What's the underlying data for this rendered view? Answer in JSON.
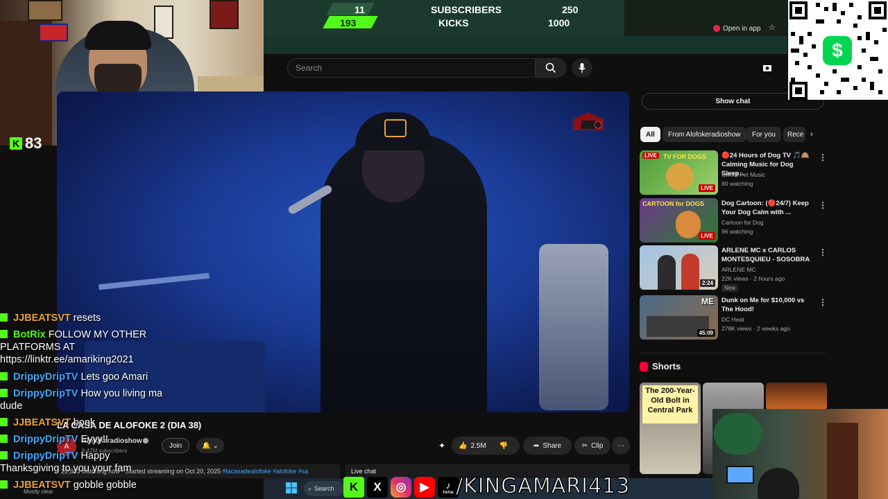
{
  "goal_bar": {
    "subs_current": "11",
    "subs_label": "SUBSCRIBERS",
    "subs_goal": "250",
    "kicks_current": "193",
    "kicks_label": "KICKS",
    "kicks_goal": "1000"
  },
  "open_in_app": "Open in app",
  "webcam": {
    "kick_count": "83"
  },
  "search": {
    "placeholder": "Search"
  },
  "video": {
    "title": "LA CASA DE ALOFOKE 2 (DIA 38)",
    "channel": "Alofokeradioshow",
    "subscribers": "8.42M subscribers",
    "join_label": "Join",
    "like_count": "2.5M",
    "share_label": "Share",
    "clip_label": "Clip",
    "description": "22,843 watching now · Started streaming on Oct 20, 2025",
    "tags": "#lacasadealofoke #alofoke #sa",
    "live_chat_label": "Live chat"
  },
  "sidebar": {
    "show_chat": "Show chat",
    "chips": [
      "All",
      "From Alofokeradioshow",
      "For you",
      "Rece"
    ],
    "recommendations": [
      {
        "title": "🔴24 Hours of Dog TV 🎵🙈 Calming Music for Dog Sleep...",
        "channel": "Sweet Pet Music",
        "meta": "80 watching",
        "badge": "LIVE",
        "thumb_text": "TV FOR DOGS",
        "thumb_colors": [
          "#4a9a3a",
          "#9ed36a"
        ]
      },
      {
        "title": "Dog Cartoon: (🔴24/7) Keep Your Dog Calm with ...",
        "channel": "Cartoon for Dog",
        "meta": "96 watching",
        "badge": "LIVE",
        "thumb_text": "CARTOON for DOGS",
        "thumb_colors": [
          "#6a3a8a",
          "#2f7a2f"
        ]
      },
      {
        "title": "ARLENE MC x CARLOS MONTESQUIEU - SOSOBRA",
        "channel": "ARLENE MC",
        "meta": "22K views · 2 hours ago",
        "badge": "2:24",
        "new": "New",
        "thumb_text": "",
        "thumb_colors": [
          "#9fc3e6",
          "#d9cdb8"
        ]
      },
      {
        "title": "Dunk on Me for $10,000 vs The Hood!",
        "channel": "DC Heat",
        "meta": "278K views · 2 weeks ago",
        "badge": "45:09",
        "thumb_text": "ME",
        "thumb_colors": [
          "#4a6a8a",
          "#8a6a4a"
        ]
      }
    ],
    "shorts_label": "Shorts",
    "short1_caption": "The 200-Year-Old Bolt in Central Park"
  },
  "chat": [
    {
      "user": "JJBEATSVT",
      "color": "#e8a23c",
      "msg": "resets"
    },
    {
      "user": "BotRix",
      "color": "#53fc18",
      "msg": "FOLLOW MY OTHER",
      "cont": [
        "PLATFORMS AT",
        "https://linktr.ee/amariking2021"
      ]
    },
    {
      "user": "DrippyDripTV",
      "color": "#3ea6ff",
      "msg": "Lets goo Amari"
    },
    {
      "user": "DrippyDripTV",
      "color": "#3ea6ff",
      "msg": "How you living ma",
      "cont": [
        "dude"
      ]
    },
    {
      "user": "JJBEATSVT",
      "color": "#e8a23c",
      "msg": "bonk"
    },
    {
      "user": "DrippyDripTV",
      "color": "#3ea6ff",
      "msg": "Eyyy!!"
    },
    {
      "user": "DrippyDripTV",
      "color": "#3ea6ff",
      "msg": "Happy",
      "cont": [
        "Thanksgiving to you your fam"
      ]
    },
    {
      "user": "JJBEATSVT",
      "color": "#e8a23c",
      "msg": "gobble gobble"
    }
  ],
  "taskbar": {
    "search_label": "Search",
    "weather": "Mostly clear"
  },
  "socials": {
    "handle": "/KINGAMARI413",
    "tiktok_label": "TikTok"
  },
  "colors": {
    "kick_green": "#53fc18",
    "yt_red": "#ff0033",
    "goal_bg": "#1b3a2d"
  }
}
